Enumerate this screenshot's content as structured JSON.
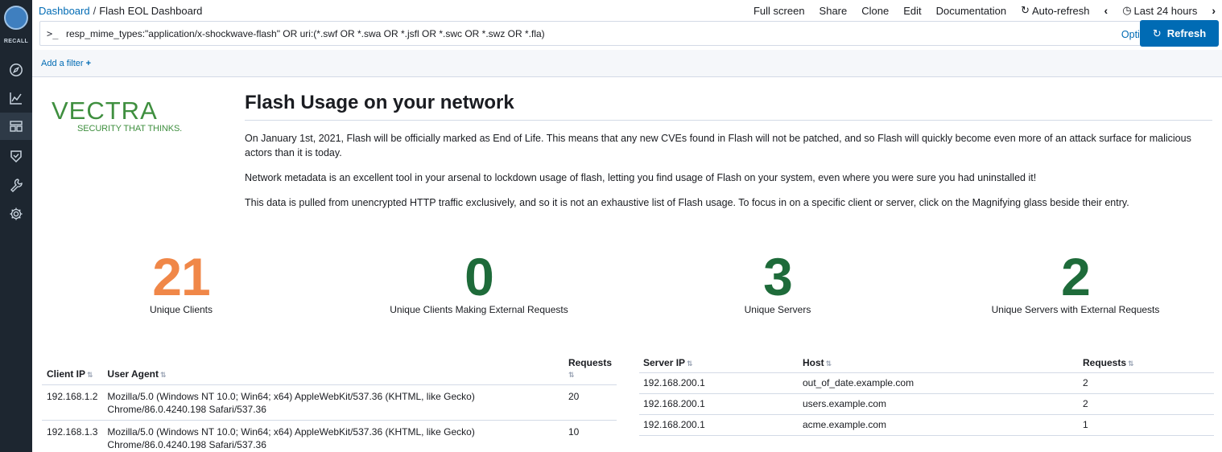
{
  "app": {
    "logo_text": "RECALL",
    "accent": "#006bb4",
    "rail_bg": "#1d2630"
  },
  "nav_icons": [
    "compass-icon",
    "chart-icon",
    "dashboard-icon",
    "shield-icon",
    "wrench-icon",
    "gear-icon"
  ],
  "breadcrumb": {
    "root": "Dashboard",
    "separator": "/",
    "current": "Flash EOL Dashboard"
  },
  "topmenu": {
    "full_screen": "Full screen",
    "share": "Share",
    "clone": "Clone",
    "edit": "Edit",
    "documentation": "Documentation",
    "auto_refresh": "Auto-refresh",
    "time_range": "Last 24 hours"
  },
  "query": {
    "prompt": ">_",
    "text": "resp_mime_types:\"application/x-shockwave-flash\" OR uri:(*.swf OR *.swa OR *.jsfl OR *.swc OR *.swz OR *.fla)",
    "options_label": "Options",
    "refresh_label": "Refresh"
  },
  "filters": {
    "add_label": "Add a filter",
    "add_symbol": "+"
  },
  "brand": {
    "name": "VECTRA",
    "tagline": "SECURITY THAT THINKS.",
    "color": "#3f8f3f"
  },
  "markdown": {
    "title": "Flash Usage on your network",
    "paragraphs": [
      "On January 1st, 2021, Flash will be officially marked as End of Life. This means that any new CVEs found in Flash will not be patched, and so Flash will quickly become even more of an attack surface for malicious actors than it is today.",
      "Network metadata is an excellent tool in your arsenal to lockdown usage of flash, letting you find usage of Flash on your system, even where you were sure you had uninstalled it!",
      "This data is pulled from unencrypted HTTP traffic exclusively, and so it is not an exhaustive list of Flash usage. To focus in on a specific client or server, click on the Magnifying glass beside their entry."
    ]
  },
  "metrics": [
    {
      "value": "21",
      "label": "Unique Clients",
      "color": "#f08748"
    },
    {
      "value": "0",
      "label": "Unique Clients Making External Requests",
      "color": "#1e6b3a"
    },
    {
      "value": "3",
      "label": "Unique Servers",
      "color": "#1e6b3a"
    },
    {
      "value": "2",
      "label": "Unique Servers with External Requests",
      "color": "#1e6b3a"
    }
  ],
  "client_table": {
    "headers": [
      "Client IP",
      "User Agent",
      "Requests"
    ],
    "rows": [
      [
        "192.168.1.2",
        "Mozilla/5.0 (Windows NT 10.0; Win64; x64) AppleWebKit/537.36 (KHTML, like Gecko) Chrome/86.0.4240.198 Safari/537.36",
        "20"
      ],
      [
        "192.168.1.3",
        "Mozilla/5.0 (Windows NT 10.0; Win64; x64) AppleWebKit/537.36 (KHTML, like Gecko) Chrome/86.0.4240.198 Safari/537.36",
        "10"
      ]
    ]
  },
  "server_table": {
    "headers": [
      "Server IP",
      "Host",
      "Requests"
    ],
    "rows": [
      [
        "192.168.200.1",
        "out_of_date.example.com",
        "2"
      ],
      [
        "192.168.200.1",
        "users.example.com",
        "2"
      ],
      [
        "192.168.200.1",
        "acme.example.com",
        "1"
      ]
    ]
  }
}
